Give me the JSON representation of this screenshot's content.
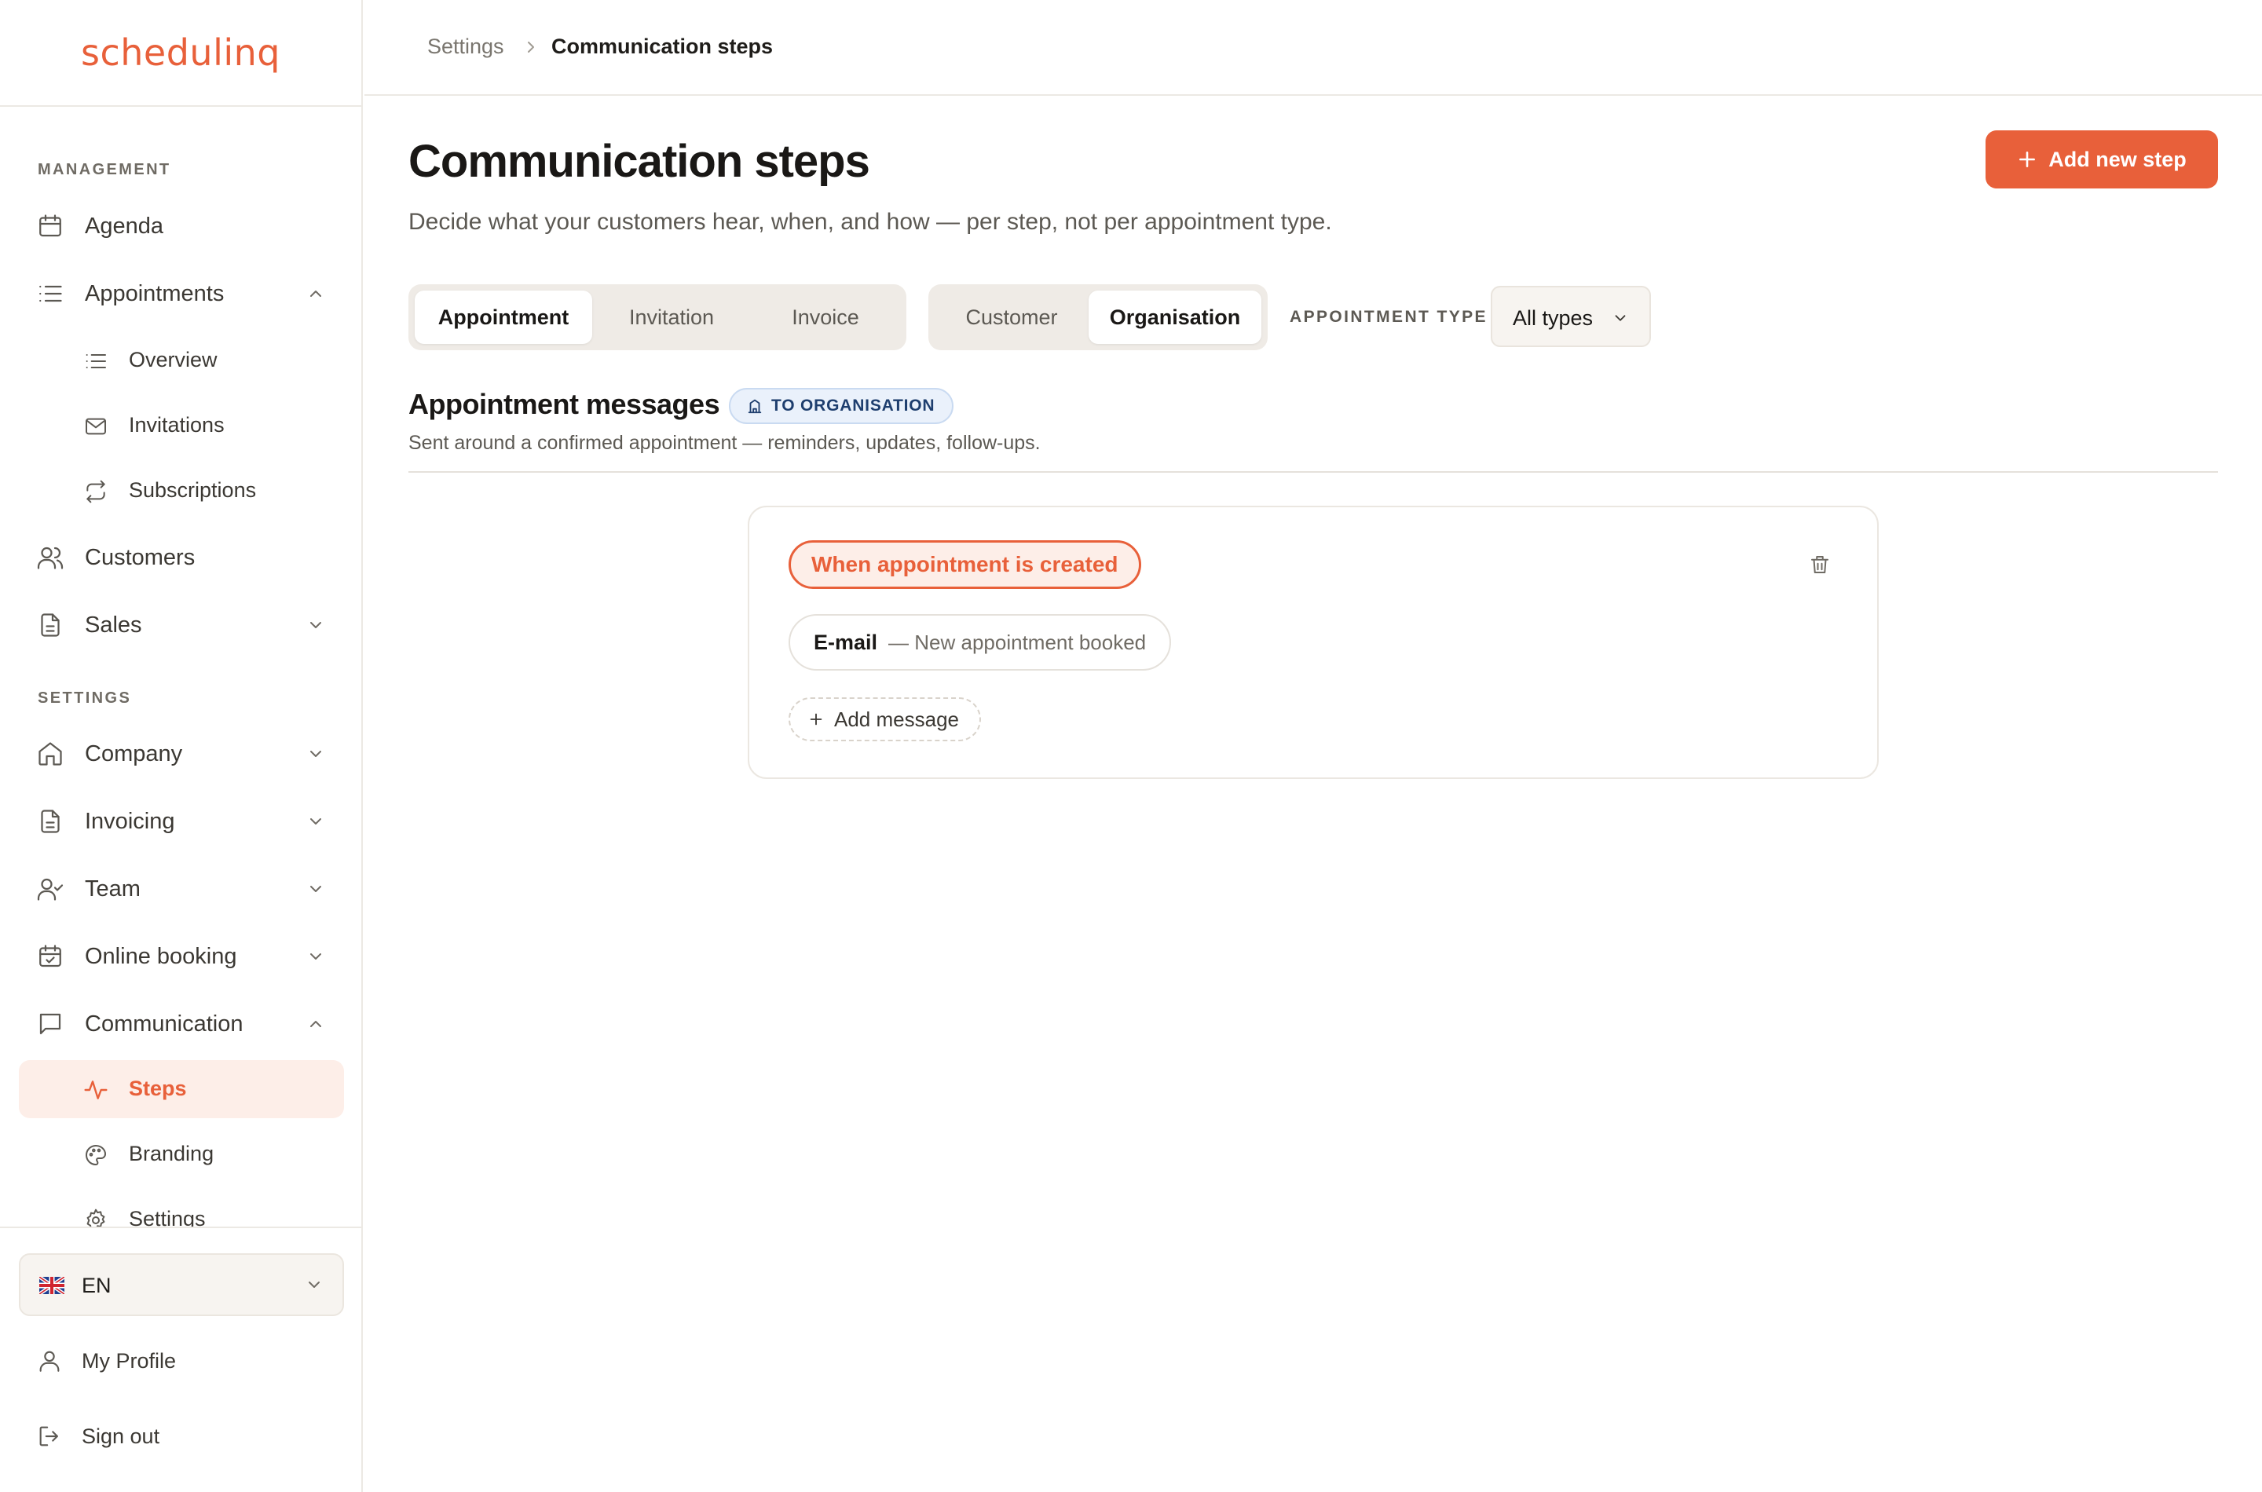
{
  "brand": {
    "logo_text": "schedulinq",
    "accent": "#e8603a"
  },
  "sidebar": {
    "sections": {
      "management": "MANAGEMENT",
      "settings": "SETTINGS"
    },
    "items": {
      "agenda": "Agenda",
      "appointments": "Appointments",
      "overview": "Overview",
      "invitations": "Invitations",
      "subscriptions": "Subscriptions",
      "customers": "Customers",
      "sales": "Sales",
      "company": "Company",
      "invoicing": "Invoicing",
      "team": "Team",
      "online_booking": "Online booking",
      "communication": "Communication",
      "steps": "Steps",
      "branding": "Branding",
      "settings": "Settings"
    },
    "language": {
      "code": "EN",
      "flag": "uk-flag-icon"
    },
    "footer": {
      "profile": "My Profile",
      "sign_out": "Sign out"
    }
  },
  "breadcrumb": {
    "parent": "Settings",
    "current": "Communication steps"
  },
  "page": {
    "title": "Communication steps",
    "subtitle": "Decide what your customers hear, when, and how — per step, not per appointment type.",
    "add_button": "Add new step"
  },
  "filters": {
    "kind_tabs": [
      "Appointment",
      "Invitation",
      "Invoice"
    ],
    "kind_selected": "Appointment",
    "audience_tabs": [
      "Customer",
      "Organisation"
    ],
    "audience_selected": "Organisation",
    "type_label": "APPOINTMENT TYPE",
    "type_value": "All types"
  },
  "section": {
    "title": "Appointment messages",
    "badge": "TO ORGANISATION",
    "subtitle": "Sent around a confirmed appointment — reminders, updates, follow-ups."
  },
  "step_card": {
    "trigger": "When appointment is created",
    "message_channel": "E-mail",
    "message_name": "— New appointment booked",
    "add_message": "Add message"
  }
}
